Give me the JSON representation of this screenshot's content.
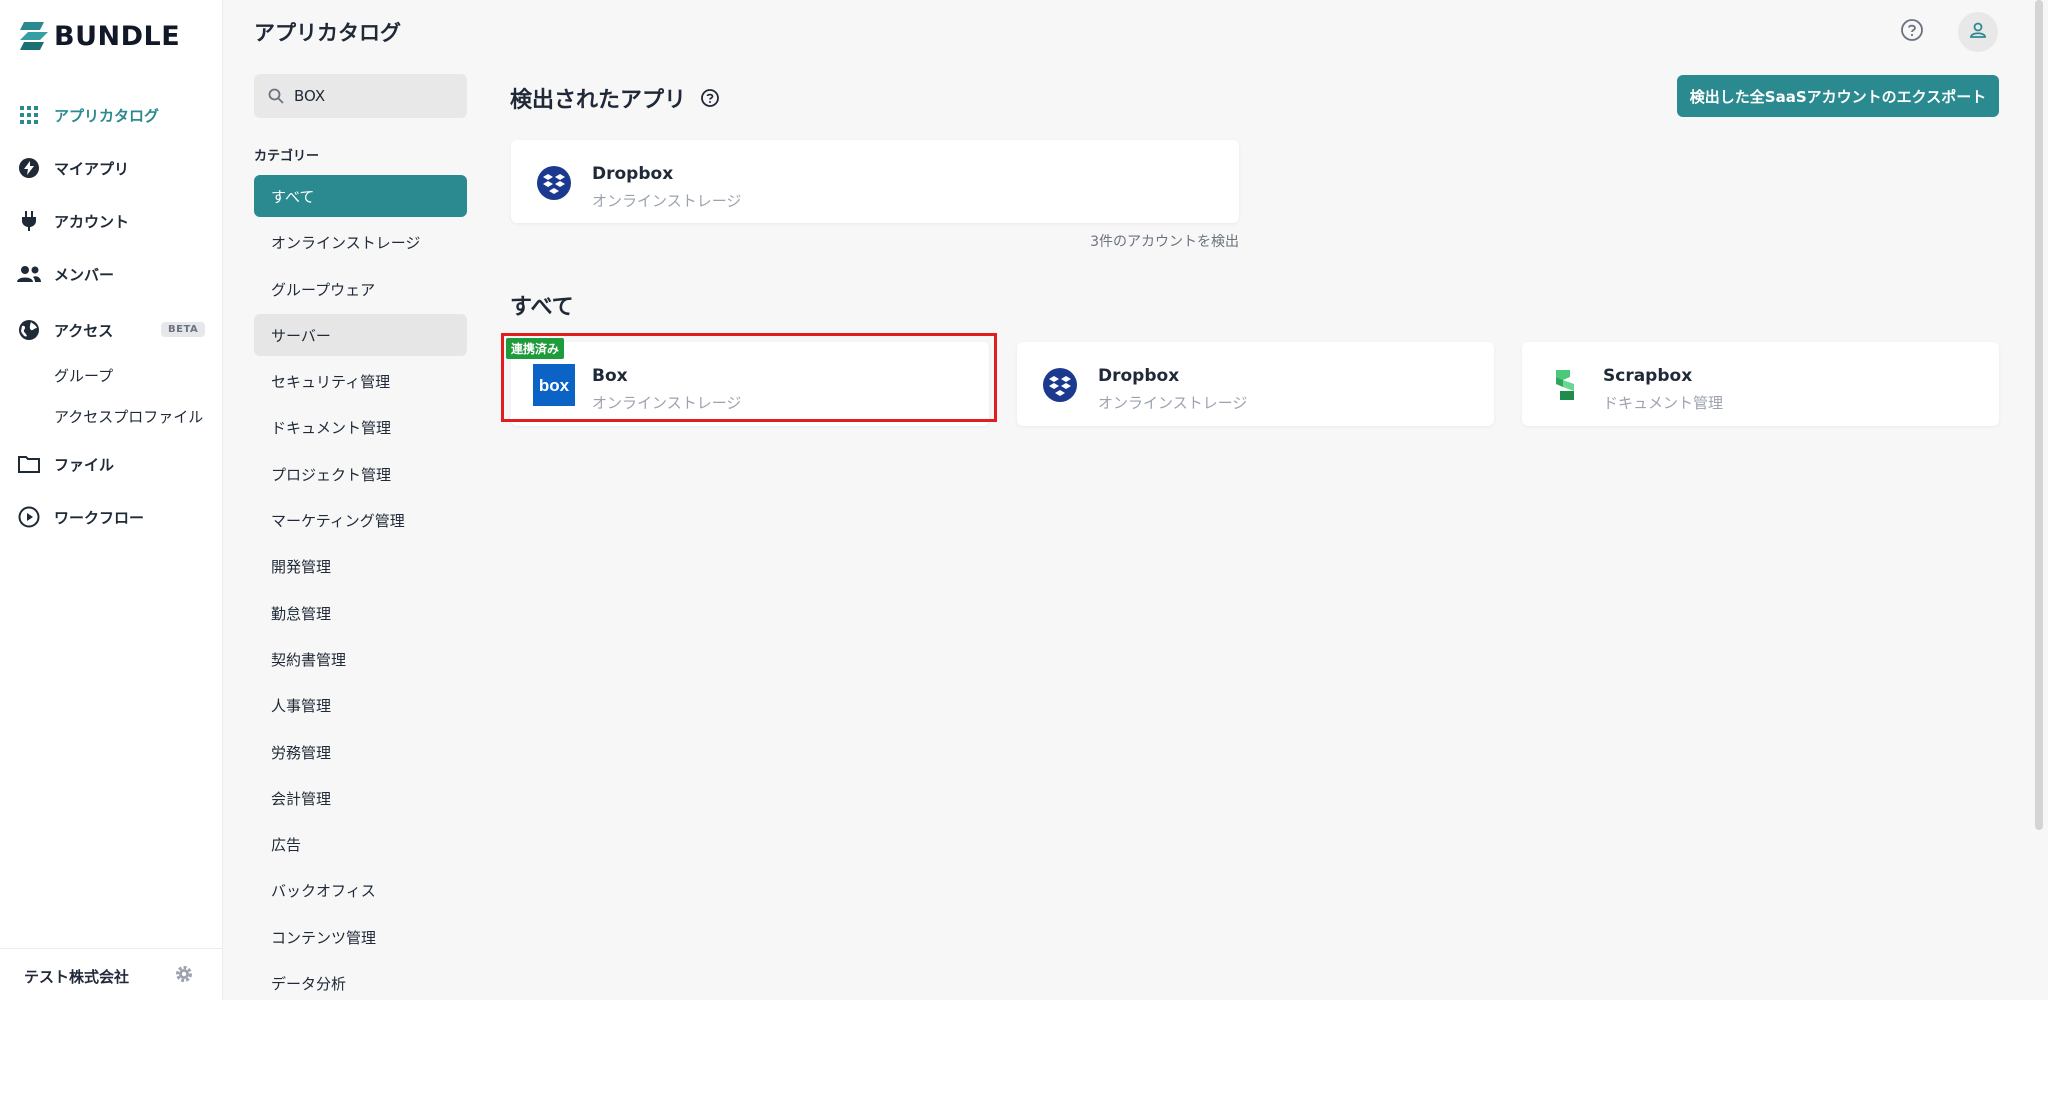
{
  "brand": {
    "name": "BUNDLE",
    "accent": "#2a8a8f"
  },
  "sidebar": {
    "items": [
      {
        "label": "アプリカタログ",
        "icon": "grid-icon",
        "active": true
      },
      {
        "label": "マイアプリ",
        "icon": "bolt-icon"
      },
      {
        "label": "アカウント",
        "icon": "plug-icon"
      },
      {
        "label": "メンバー",
        "icon": "people-icon"
      },
      {
        "label": "アクセス",
        "icon": "globe-icon",
        "badge": "BETA"
      },
      {
        "label": "ファイル",
        "icon": "folder-icon"
      },
      {
        "label": "ワークフロー",
        "icon": "play-circle-icon"
      }
    ],
    "access_sub": [
      "グループ",
      "アクセスプロファイル"
    ],
    "company": "テスト株式会社"
  },
  "header": {
    "title": "アプリカタログ"
  },
  "search": {
    "value": "BOX"
  },
  "categories": {
    "heading": "カテゴリー",
    "items": [
      "すべて",
      "オンラインストレージ",
      "グループウェア",
      "サーバー",
      "セキュリティ管理",
      "ドキュメント管理",
      "プロジェクト管理",
      "マーケティング管理",
      "開発管理",
      "勤怠管理",
      "契約書管理",
      "人事管理",
      "労務管理",
      "会計管理",
      "広告",
      "バックオフィス",
      "コンテンツ管理",
      "データ分析"
    ],
    "selected": "すべて"
  },
  "detected": {
    "title": "検出されたアプリ",
    "export_label": "検出した全SaaSアカウントのエクスポート",
    "apps": [
      {
        "name": "Dropbox",
        "category": "オンラインストレージ"
      }
    ],
    "count_text": "3件のアカウントを検出"
  },
  "all": {
    "title": "すべて",
    "apps": [
      {
        "name": "Box",
        "category": "オンラインストレージ",
        "badge": "連携済み"
      },
      {
        "name": "Dropbox",
        "category": "オンラインストレージ"
      },
      {
        "name": "Scrapbox",
        "category": "ドキュメント管理"
      }
    ]
  }
}
